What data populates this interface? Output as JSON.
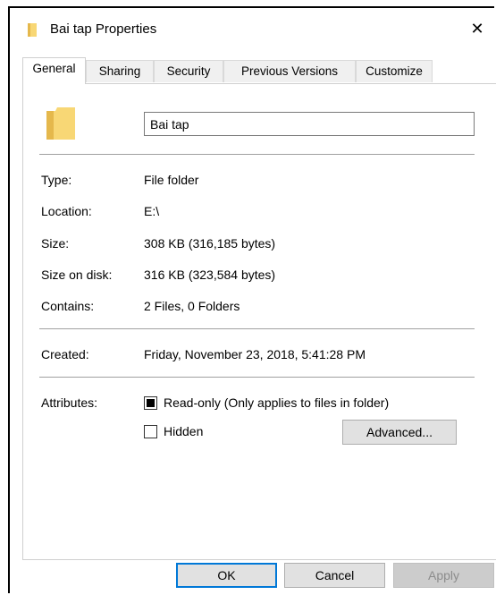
{
  "window": {
    "title": "Bai tap Properties",
    "close_glyph": "✕"
  },
  "tabs": [
    {
      "label": "General",
      "active": true
    },
    {
      "label": "Sharing",
      "active": false
    },
    {
      "label": "Security",
      "active": false
    },
    {
      "label": "Previous Versions",
      "active": false
    },
    {
      "label": "Customize",
      "active": false
    }
  ],
  "general": {
    "folder_name": "Bai tap",
    "properties": [
      {
        "label": "Type:",
        "value": "File folder"
      },
      {
        "label": "Location:",
        "value": "E:\\"
      },
      {
        "label": "Size:",
        "value": "308 KB (316,185 bytes)"
      },
      {
        "label": "Size on disk:",
        "value": "316 KB (323,584 bytes)"
      },
      {
        "label": "Contains:",
        "value": "2 Files, 0 Folders"
      }
    ],
    "created_label": "Created:",
    "created_value": "Friday, November 23, 2018, 5:41:28 PM",
    "attributes_label": "Attributes:",
    "readonly_label": "Read-only (Only applies to files in folder)",
    "readonly_state": "indeterminate",
    "hidden_label": "Hidden",
    "hidden_checked": false,
    "advanced_label": "Advanced..."
  },
  "buttons": {
    "ok": "OK",
    "cancel": "Cancel",
    "apply": "Apply"
  },
  "colors": {
    "folder_yellow": "#f8d775",
    "folder_dark": "#e5b84c",
    "accent_blue": "#0078d7"
  },
  "icons": {
    "title": "folder-icon",
    "close": "close-icon",
    "big": "folder-icon"
  }
}
